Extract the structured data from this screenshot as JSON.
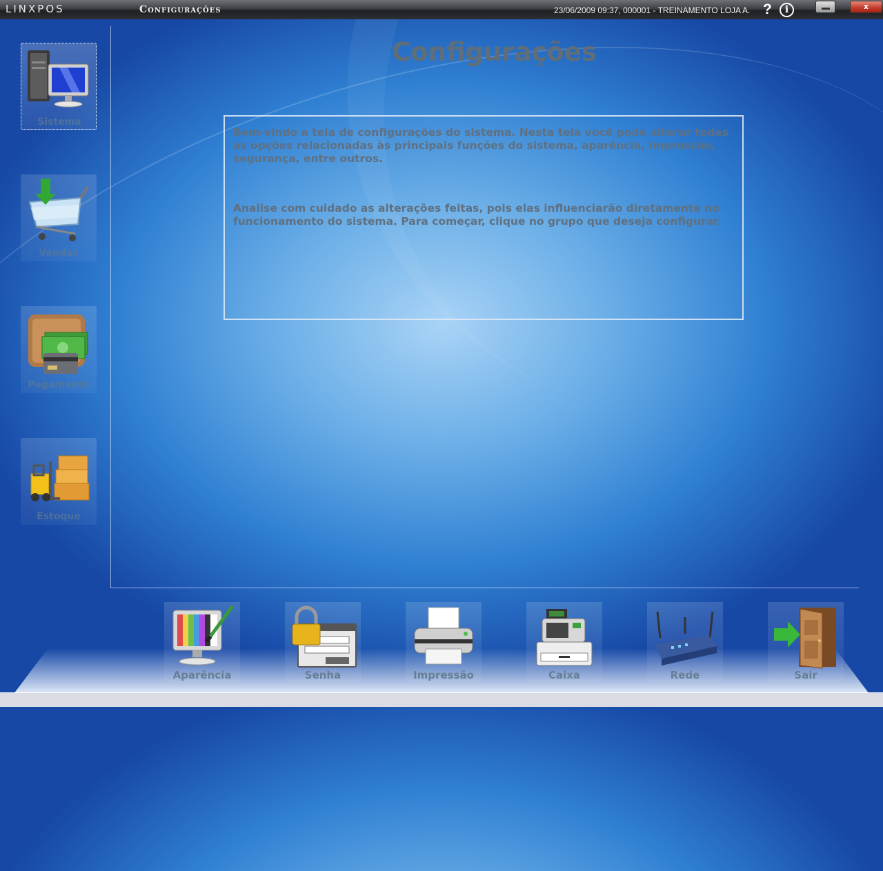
{
  "titlebar": {
    "app_logo": "LINXPOS",
    "window_title": "Configurações",
    "status": "23/06/2009 09:37, 000001 - TREINAMENTO LOJA A.",
    "help_symbol": "?",
    "info_symbol": "i",
    "close_symbol": "x"
  },
  "main": {
    "title": "Configurações",
    "paragraph_1": "Bem-vindo a tela de configurações do sistema. Nesta tela você pode alterar todas as opções relacionadas às principais funções do sistema, aparência, impressão, segurança, entre outros.",
    "paragraph_2": "Analise com cuidado as alterações feitas, pois elas influenciarão diretamente no funcionamento do sistema. Para começar, clique no grupo que deseja configurar."
  },
  "sidebar": {
    "items": [
      {
        "label": "Sistema",
        "icon": "computer-icon",
        "selected": true
      },
      {
        "label": "Vendas",
        "icon": "shopping-cart-icon",
        "selected": false
      },
      {
        "label": "Pagamento",
        "icon": "wallet-icon",
        "selected": false
      },
      {
        "label": "Estoque",
        "icon": "forklift-boxes-icon",
        "selected": false
      }
    ]
  },
  "bottombar": {
    "items": [
      {
        "label": "Aparência",
        "icon": "monitor-palette-icon"
      },
      {
        "label": "Senha",
        "icon": "padlock-login-icon"
      },
      {
        "label": "Impressão",
        "icon": "printer-icon"
      },
      {
        "label": "Caixa",
        "icon": "cash-register-icon"
      },
      {
        "label": "Rede",
        "icon": "wireless-router-icon"
      },
      {
        "label": "Sair",
        "icon": "exit-door-icon"
      }
    ]
  },
  "colors": {
    "background_center": "#a9d3f6",
    "background_edge": "#1748a6",
    "text_muted": "#5f6e78",
    "close_button": "#c0392b"
  }
}
